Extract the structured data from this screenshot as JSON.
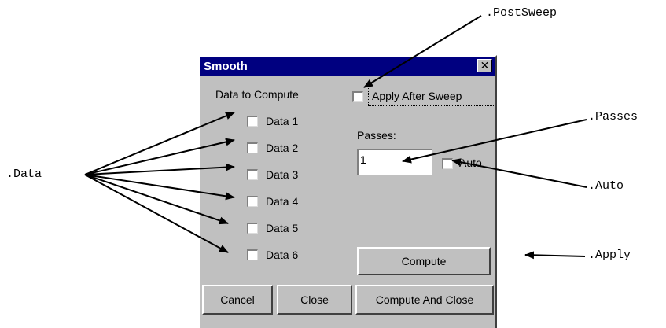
{
  "annotations": {
    "post_sweep": ".PostSweep",
    "passes": ".Passes",
    "data": ".Data",
    "auto": ".Auto",
    "apply": ".Apply"
  },
  "dialog": {
    "title": "Smooth",
    "close_glyph": "✕",
    "data_heading": "Data to Compute",
    "apply_after_sweep_label": "Apply After Sweep",
    "apply_after_sweep_checked": false,
    "data_items": [
      {
        "label": "Data 1",
        "checked": false
      },
      {
        "label": "Data 2",
        "checked": false
      },
      {
        "label": "Data 3",
        "checked": false
      },
      {
        "label": "Data 4",
        "checked": false
      },
      {
        "label": "Data 5",
        "checked": false
      },
      {
        "label": "Data 6",
        "checked": false
      }
    ],
    "passes_label": "Passes:",
    "passes_value": "1",
    "auto_label": "Auto",
    "auto_checked": false,
    "compute_label": "Compute",
    "cancel_label": "Cancel",
    "close_label": "Close",
    "compute_and_close_label": "Compute And Close"
  }
}
